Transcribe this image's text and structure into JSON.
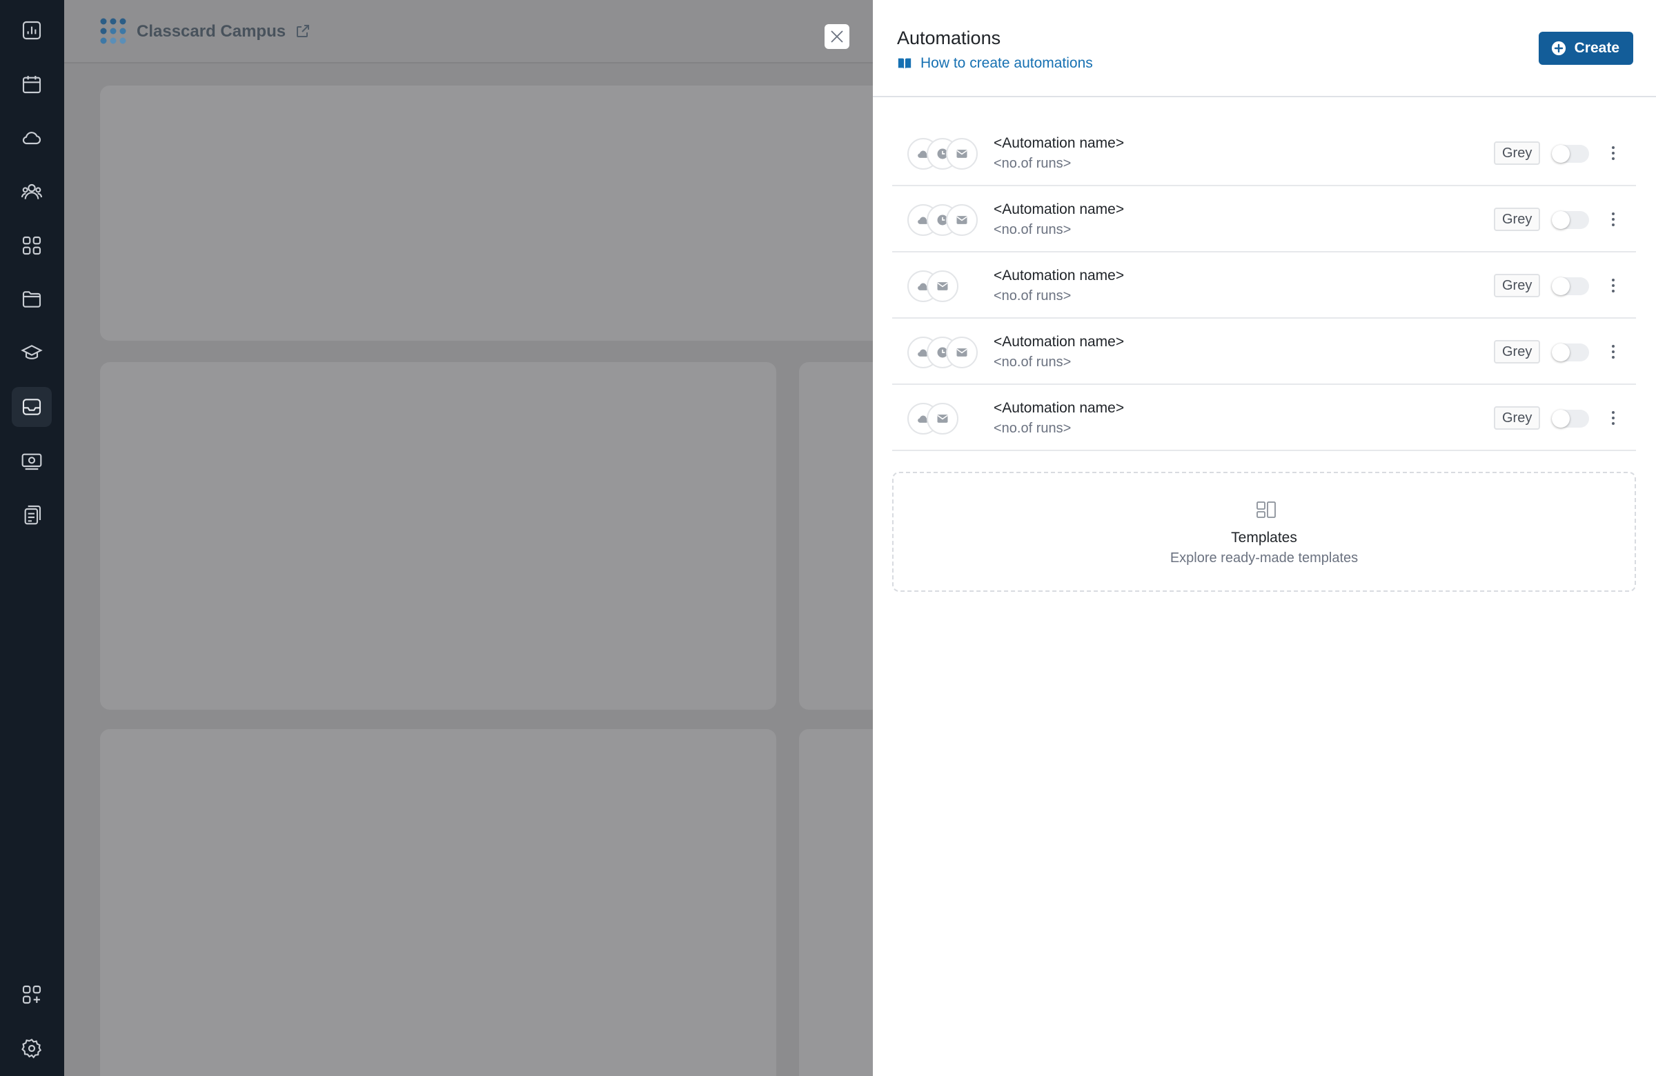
{
  "app": {
    "title": "Classcard Campus"
  },
  "colors": {
    "rail_bg": "#141c26",
    "primary": "#135d99",
    "link": "#1670b2",
    "overlay": "#8c8c8e"
  },
  "rail": {
    "items": [
      {
        "icon": "analytics-icon",
        "active": false
      },
      {
        "icon": "calendar-icon",
        "active": false
      },
      {
        "icon": "cloud-icon",
        "active": false
      },
      {
        "icon": "users-icon",
        "active": false
      },
      {
        "icon": "apps-grid-icon",
        "active": false
      },
      {
        "icon": "folder-icon",
        "active": false
      },
      {
        "icon": "graduation-cap-icon",
        "active": false
      },
      {
        "icon": "inbox-icon",
        "active": true
      },
      {
        "icon": "money-icon",
        "active": false
      },
      {
        "icon": "documents-icon",
        "active": false
      },
      {
        "icon": "add-apps-icon",
        "active": false
      },
      {
        "icon": "settings-gear-icon",
        "active": false
      }
    ]
  },
  "drawer": {
    "title": "Automations",
    "help_link": "How to create automations",
    "create_label": "Create",
    "rows": [
      {
        "name": "<Automation name>",
        "runs": "<no.of runs>",
        "tag": "Grey",
        "enabled": false,
        "icons": [
          "cloud-icon",
          "clock-icon",
          "mail-icon"
        ]
      },
      {
        "name": "<Automation name>",
        "runs": "<no.of runs>",
        "tag": "Grey",
        "enabled": false,
        "icons": [
          "cloud-icon",
          "clock-icon",
          "mail-icon"
        ]
      },
      {
        "name": "<Automation name>",
        "runs": "<no.of runs>",
        "tag": "Grey",
        "enabled": false,
        "icons": [
          "cloud-icon",
          "mail-icon"
        ]
      },
      {
        "name": "<Automation name>",
        "runs": "<no.of runs>",
        "tag": "Grey",
        "enabled": false,
        "icons": [
          "cloud-icon",
          "clock-icon",
          "mail-icon"
        ]
      },
      {
        "name": "<Automation name>",
        "runs": "<no.of runs>",
        "tag": "Grey",
        "enabled": false,
        "icons": [
          "cloud-icon",
          "mail-icon"
        ]
      }
    ],
    "templates": {
      "title": "Templates",
      "subtitle": "Explore ready-made templates"
    }
  }
}
